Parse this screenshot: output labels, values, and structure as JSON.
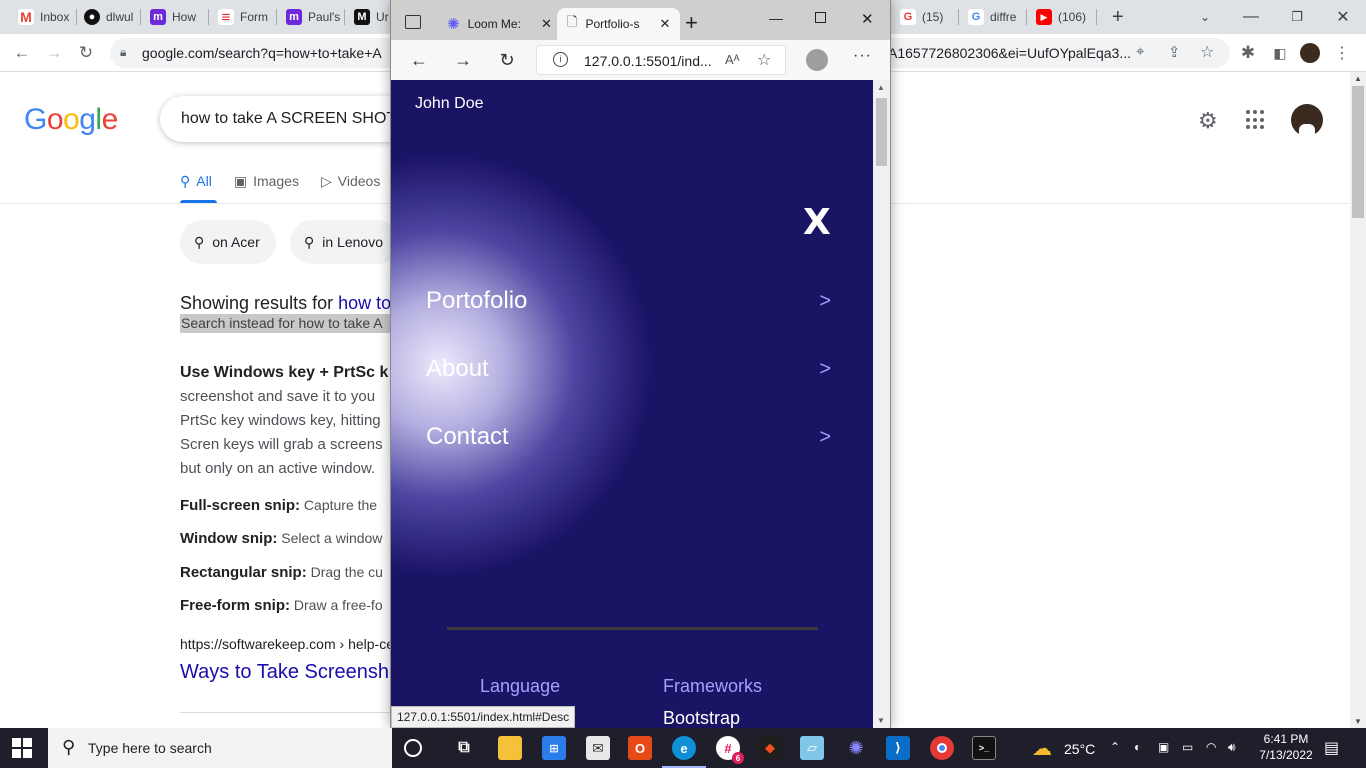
{
  "chrome": {
    "tabs": [
      "Inbox",
      "dlwul",
      "How",
      "Form",
      "Paul's",
      "Ur",
      "(15)",
      "diffre",
      "(106)"
    ],
    "new_tab": "+",
    "url_left": "google.com/search?q=how+to+take+A",
    "url_right": "A1657726802306&ei=UufOYpalEqa3..."
  },
  "google": {
    "logo": [
      "G",
      "o",
      "o",
      "g",
      "l",
      "e"
    ],
    "query": "how to take A SCREEN SHOT",
    "tabs": [
      "All",
      "Images",
      "Videos"
    ],
    "chips": [
      "on Acer",
      "in Lenovo"
    ],
    "showing_prefix": "Showing results for ",
    "showing_link": "how to",
    "search_instead": "Search instead for how to take A",
    "snippet_head": "Use Windows key + PrtSc k",
    "snippet_lines": [
      "screenshot and save it to you",
      "PrtSc key windows key, hitting",
      "Scren keys will grab a screens",
      "but only on an active window."
    ],
    "bullets": [
      {
        "bold": "Full-screen snip:",
        "text": " Capture the"
      },
      {
        "bold": "Window snip:",
        "text": " Select a window"
      },
      {
        "bold": "Rectangular snip:",
        "text": " Drag the cu"
      },
      {
        "bold": "Free-form snip:",
        "text": " Draw a free-fo"
      }
    ],
    "result_url": "https://softwarekeep.com › help-ce",
    "result_title": "Ways to Take Screensh"
  },
  "edge": {
    "tabs": [
      {
        "label": "Loom Me:",
        "close": "✕"
      },
      {
        "label": "Portfolio-s",
        "close": "✕"
      }
    ],
    "new_tab": "+",
    "url": "127.0.0.1:5501/ind...",
    "more": "···"
  },
  "site": {
    "brand": "John Doe",
    "close": "X",
    "menu": [
      {
        "label": "Portofolio",
        "arrow": ">"
      },
      {
        "label": "About",
        "arrow": ">"
      },
      {
        "label": "Contact",
        "arrow": ">"
      }
    ],
    "col1_head": "Language",
    "col2_head": "Frameworks",
    "col2_item": "Bootstrap",
    "status_url": "127.0.0.1:5501/index.html#Desc"
  },
  "taskbar": {
    "search_placeholder": "Type here to search",
    "temperature": "25°C",
    "time": "6:41 PM",
    "date": "7/13/2022",
    "badge": "6"
  },
  "colors": {
    "site_bg": "#1a1464",
    "accent_purple": "#a3a0ff",
    "google_link": "#1a0dab"
  }
}
